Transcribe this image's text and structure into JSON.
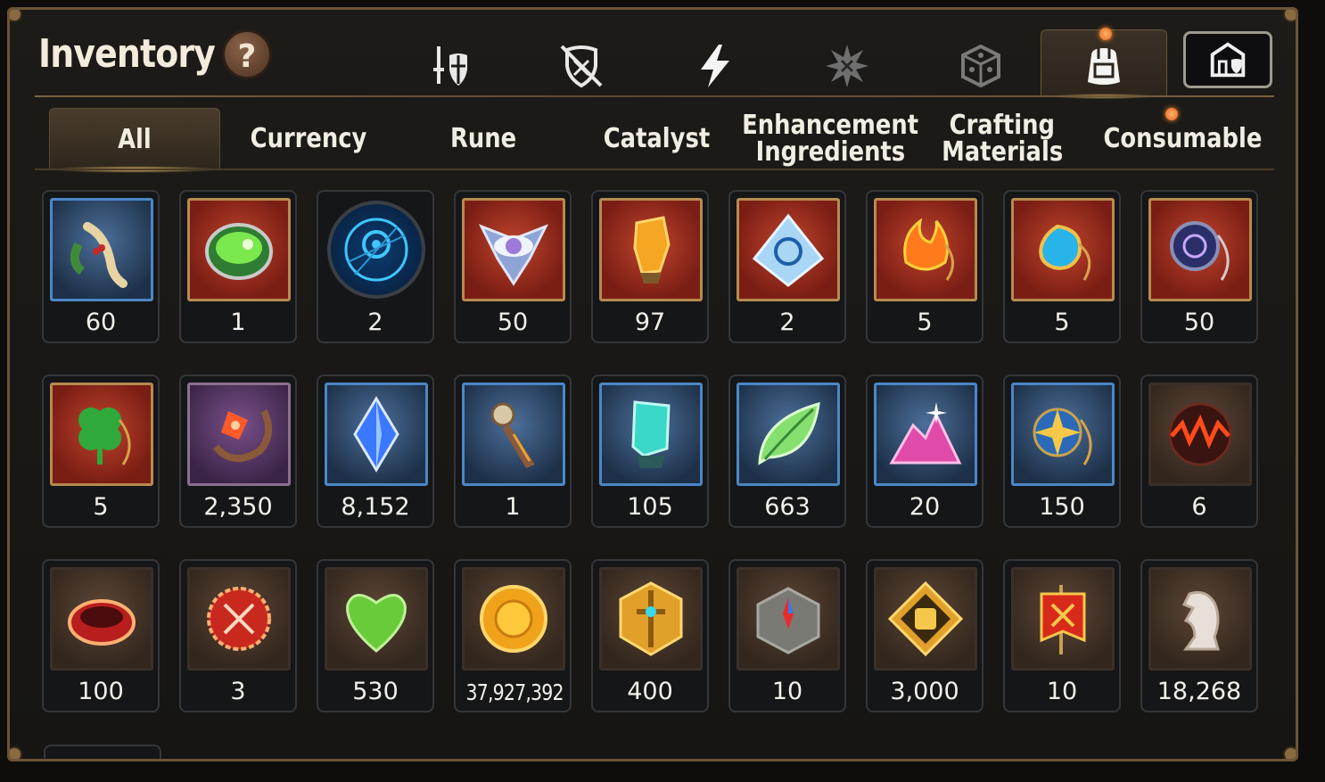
{
  "header": {
    "title": "Inventory",
    "help_label": "?"
  },
  "category_icons": [
    {
      "name": "sword-shield-icon",
      "active": false
    },
    {
      "name": "broken-shield-icon",
      "active": false
    },
    {
      "name": "lightning-icon",
      "active": false
    },
    {
      "name": "starburst-emblem-icon",
      "active": false
    },
    {
      "name": "dice-icon",
      "active": false
    },
    {
      "name": "backpack-icon",
      "active": true,
      "notification": true
    },
    {
      "name": "exit-castle-icon",
      "active": false
    }
  ],
  "tabs": [
    {
      "label": "All",
      "active": true
    },
    {
      "label": "Currency",
      "active": false
    },
    {
      "label": "Rune",
      "active": false
    },
    {
      "label": "Catalyst",
      "active": false
    },
    {
      "label": "Enhancement Ingredients",
      "line1": "Enhancement",
      "line2": "Ingredients",
      "active": false
    },
    {
      "label": "Crafting Materials",
      "line1": "Crafting",
      "line2": "Materials",
      "active": false
    },
    {
      "label": "Consumable",
      "active": false,
      "notification": true
    }
  ],
  "items": [
    {
      "icon": "ginseng-root-icon",
      "frame": "blue",
      "quantity": "60"
    },
    {
      "icon": "green-gem-icon",
      "frame": "red",
      "quantity": "1"
    },
    {
      "icon": "blue-rune-orb-icon",
      "frame": "round",
      "quantity": "2"
    },
    {
      "icon": "eye-crystal-icon",
      "frame": "red",
      "quantity": "50"
    },
    {
      "icon": "amber-crystal-icon",
      "frame": "red",
      "quantity": "97"
    },
    {
      "icon": "triquetra-pyramid-icon",
      "frame": "red",
      "quantity": "2"
    },
    {
      "icon": "fire-pendant-icon",
      "frame": "red",
      "quantity": "5"
    },
    {
      "icon": "water-pendant-icon",
      "frame": "red",
      "quantity": "5"
    },
    {
      "icon": "moon-pendant-icon",
      "frame": "red",
      "quantity": "50"
    },
    {
      "icon": "clover-pendant-icon",
      "frame": "red",
      "quantity": "5"
    },
    {
      "icon": "ring-amulet-icon",
      "frame": "purple",
      "quantity": "2,350"
    },
    {
      "icon": "blue-crystal-icon",
      "frame": "blue",
      "quantity": "8,152"
    },
    {
      "icon": "enchanted-dagger-icon",
      "frame": "blue",
      "quantity": "1"
    },
    {
      "icon": "teal-crystal-icon",
      "frame": "blue",
      "quantity": "105"
    },
    {
      "icon": "green-leaf-icon",
      "frame": "blue",
      "quantity": "663"
    },
    {
      "icon": "pink-crystal-pile-icon",
      "frame": "blue",
      "quantity": "20"
    },
    {
      "icon": "star-pendant-icon",
      "frame": "blue",
      "quantity": "150"
    },
    {
      "icon": "fire-orb-icon",
      "frame": "brown",
      "quantity": "6"
    },
    {
      "icon": "red-ring-icon",
      "frame": "brown",
      "quantity": "100"
    },
    {
      "icon": "red-badge-icon",
      "frame": "brown",
      "quantity": "3"
    },
    {
      "icon": "green-heart-icon",
      "frame": "brown",
      "quantity": "530"
    },
    {
      "icon": "gold-coin-icon",
      "frame": "brown",
      "quantity": "37,927,392"
    },
    {
      "icon": "gold-sword-emblem-icon",
      "frame": "brown",
      "quantity": "400"
    },
    {
      "icon": "stone-compass-icon",
      "frame": "brown",
      "quantity": "10"
    },
    {
      "icon": "fist-emblem-icon",
      "frame": "brown",
      "quantity": "3,000"
    },
    {
      "icon": "war-banner-icon",
      "frame": "brown",
      "quantity": "10"
    },
    {
      "icon": "chess-knight-icon",
      "frame": "brown",
      "quantity": "18,268"
    }
  ],
  "colors": {
    "frame_gold": "#6b5436",
    "accent_glow": "#f4c56a",
    "notification": "#ff8a2a",
    "text": "#f2f0ea"
  }
}
